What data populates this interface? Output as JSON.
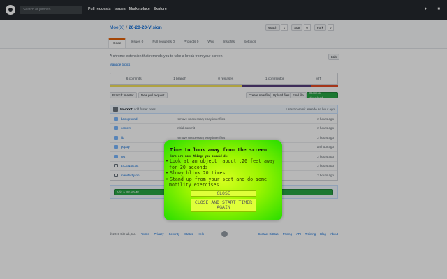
{
  "header": {
    "search_placeholder": "Search or jump to...",
    "nav": [
      "Pull requests",
      "Issues",
      "Marketplace",
      "Explore"
    ],
    "right_icons": [
      "bell-icon",
      "plus-icon",
      "avatar-icon"
    ]
  },
  "repo": {
    "owner": "Moe(X)",
    "name": "20-20-20-Vision",
    "watch_label": "Watch",
    "watch_count": "1",
    "star_label": "Star",
    "star_count": "0",
    "fork_label": "Fork",
    "fork_count": "0",
    "tabs": [
      "Code",
      "Issues 0",
      "Pull requests 0",
      "Projects 0",
      "Wiki",
      "Insights",
      "Settings"
    ],
    "description": "A chrome extension that reminds you to take a break from your screen.",
    "manage_topics": "Manage topics",
    "edit_label": "Edit",
    "stats": [
      "6 commits",
      "1 branch",
      "0 releases",
      "1 contributor",
      "MIT"
    ],
    "branch_button": "Branch: master",
    "new_pr_button": "New pull request",
    "create_file_button": "Create new file",
    "upload_files_button": "Upload files",
    "find_file_button": "Find file",
    "clone_button": "Clone or download",
    "commit": {
      "author": "MoeXXT",
      "message": "add faster ones",
      "latest": "Latest commit a0eede an hour ago"
    },
    "files": [
      {
        "name": "background",
        "message": "remove unecessary easytimer files",
        "age": "2 hours ago",
        "type": "folder"
      },
      {
        "name": "content",
        "message": "initial commit",
        "age": "2 hours ago",
        "type": "folder"
      },
      {
        "name": "lib",
        "message": "remove unecessary easytimer files",
        "age": "2 hours ago",
        "type": "folder"
      },
      {
        "name": "popup",
        "message": "",
        "age": "an hour ago",
        "type": "folder"
      },
      {
        "name": "res",
        "message": "",
        "age": "2 hours ago",
        "type": "folder"
      },
      {
        "name": "LICENSE.txt",
        "message": "",
        "age": "2 hours ago",
        "type": "file"
      },
      {
        "name": "manifest.json",
        "message": "",
        "age": "2 hours ago",
        "type": "file"
      }
    ],
    "readme_prompt": "Help people interested in this repository",
    "add_readme_button": "Add a README"
  },
  "footer": {
    "copyright": "© 2019 GitHub, Inc.",
    "left_links": [
      "Terms",
      "Privacy",
      "Security",
      "Status",
      "Help"
    ],
    "right_links": [
      "Contact GitHub",
      "Pricing",
      "API",
      "Training",
      "Blog",
      "About"
    ]
  },
  "popup": {
    "title": "Time to look away from the screen",
    "subtitle": "Here are some things you should do:",
    "tips": [
      "Look at an object ,about ,20 feet away for 20 seconds",
      "Slowy blink 20 times",
      "Stand up from your seat and do some mobility exercises"
    ],
    "close_button": "CLOSE",
    "restart_button": "CLOSE AND START TIMER\nAGAIN"
  },
  "colors": {
    "header_bg": "#24292e",
    "popup_center": "#d6ff1f",
    "popup_edge": "#27dd00",
    "lang_js": "#f1e05a",
    "lang_html": "#e34c26",
    "lang_css": "#563d7c"
  }
}
